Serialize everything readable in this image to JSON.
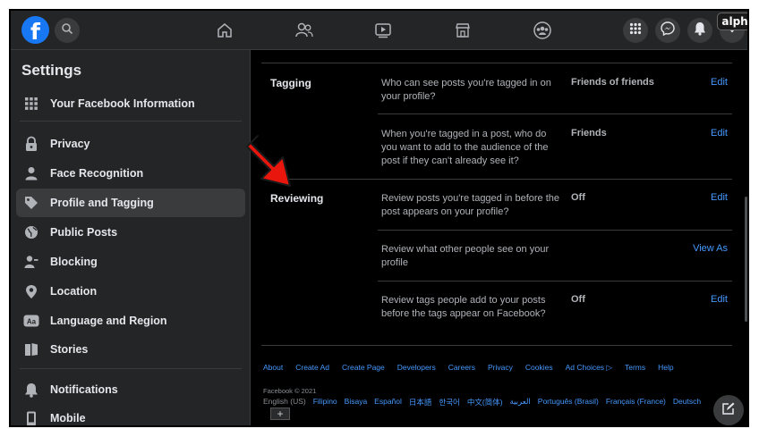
{
  "brand": {
    "logo_letter": "f",
    "watermark": "alphr"
  },
  "colors": {
    "accent": "#1877f2",
    "link": "#4599ff",
    "arrow": "#e8160c"
  },
  "topbar": {
    "icons": [
      "search-icon",
      "home-icon",
      "friends-icon",
      "watch-icon",
      "marketplace-icon",
      "groups-icon",
      "menu-grid-icon",
      "messenger-icon",
      "notifications-icon",
      "account-caret-icon"
    ]
  },
  "sidebar": {
    "title": "Settings",
    "items": [
      {
        "label": "Your Facebook Information",
        "icon": "grid-icon"
      },
      {
        "label": "Privacy",
        "icon": "lock-icon"
      },
      {
        "label": "Face Recognition",
        "icon": "person-icon"
      },
      {
        "label": "Profile and Tagging",
        "icon": "tag-icon",
        "active": true
      },
      {
        "label": "Public Posts",
        "icon": "globe-icon"
      },
      {
        "label": "Blocking",
        "icon": "block-user-icon"
      },
      {
        "label": "Location",
        "icon": "location-pin-icon"
      },
      {
        "label": "Language and Region",
        "icon": "language-icon"
      },
      {
        "label": "Stories",
        "icon": "stories-icon"
      },
      {
        "label": "Notifications",
        "icon": "bell-icon"
      },
      {
        "label": "Mobile",
        "icon": "mobile-icon"
      }
    ]
  },
  "main": {
    "tagging": {
      "title": "Tagging",
      "rows": [
        {
          "desc": "Who can see posts you're tagged in on your profile?",
          "value": "Friends of friends",
          "action": "Edit"
        },
        {
          "desc": "When you're tagged in a post, who do you want to add to the audience of the post if they can't already see it?",
          "value": "Friends",
          "action": "Edit"
        }
      ]
    },
    "reviewing": {
      "title": "Reviewing",
      "rows": [
        {
          "desc": "Review posts you're tagged in before the post appears on your profile?",
          "value": "Off",
          "action": "Edit"
        },
        {
          "desc": "Review what other people see on your profile",
          "value": "",
          "action": "View As"
        },
        {
          "desc": "Review tags people add to your posts before the tags appear on Facebook?",
          "value": "Off",
          "action": "Edit"
        }
      ]
    }
  },
  "footer": {
    "links": [
      "About",
      "Create Ad",
      "Create Page",
      "Developers",
      "Careers",
      "Privacy",
      "Cookies",
      "Ad Choices",
      "Terms",
      "Help"
    ],
    "copyright": "Facebook © 2021",
    "current_language": "English (US)",
    "languages": [
      "Filipino",
      "Bisaya",
      "Español",
      "日本語",
      "한국어",
      "中文(简体)",
      "العربية",
      "Português (Brasil)",
      "Français (France)",
      "Deutsch"
    ],
    "more_button": "+"
  }
}
